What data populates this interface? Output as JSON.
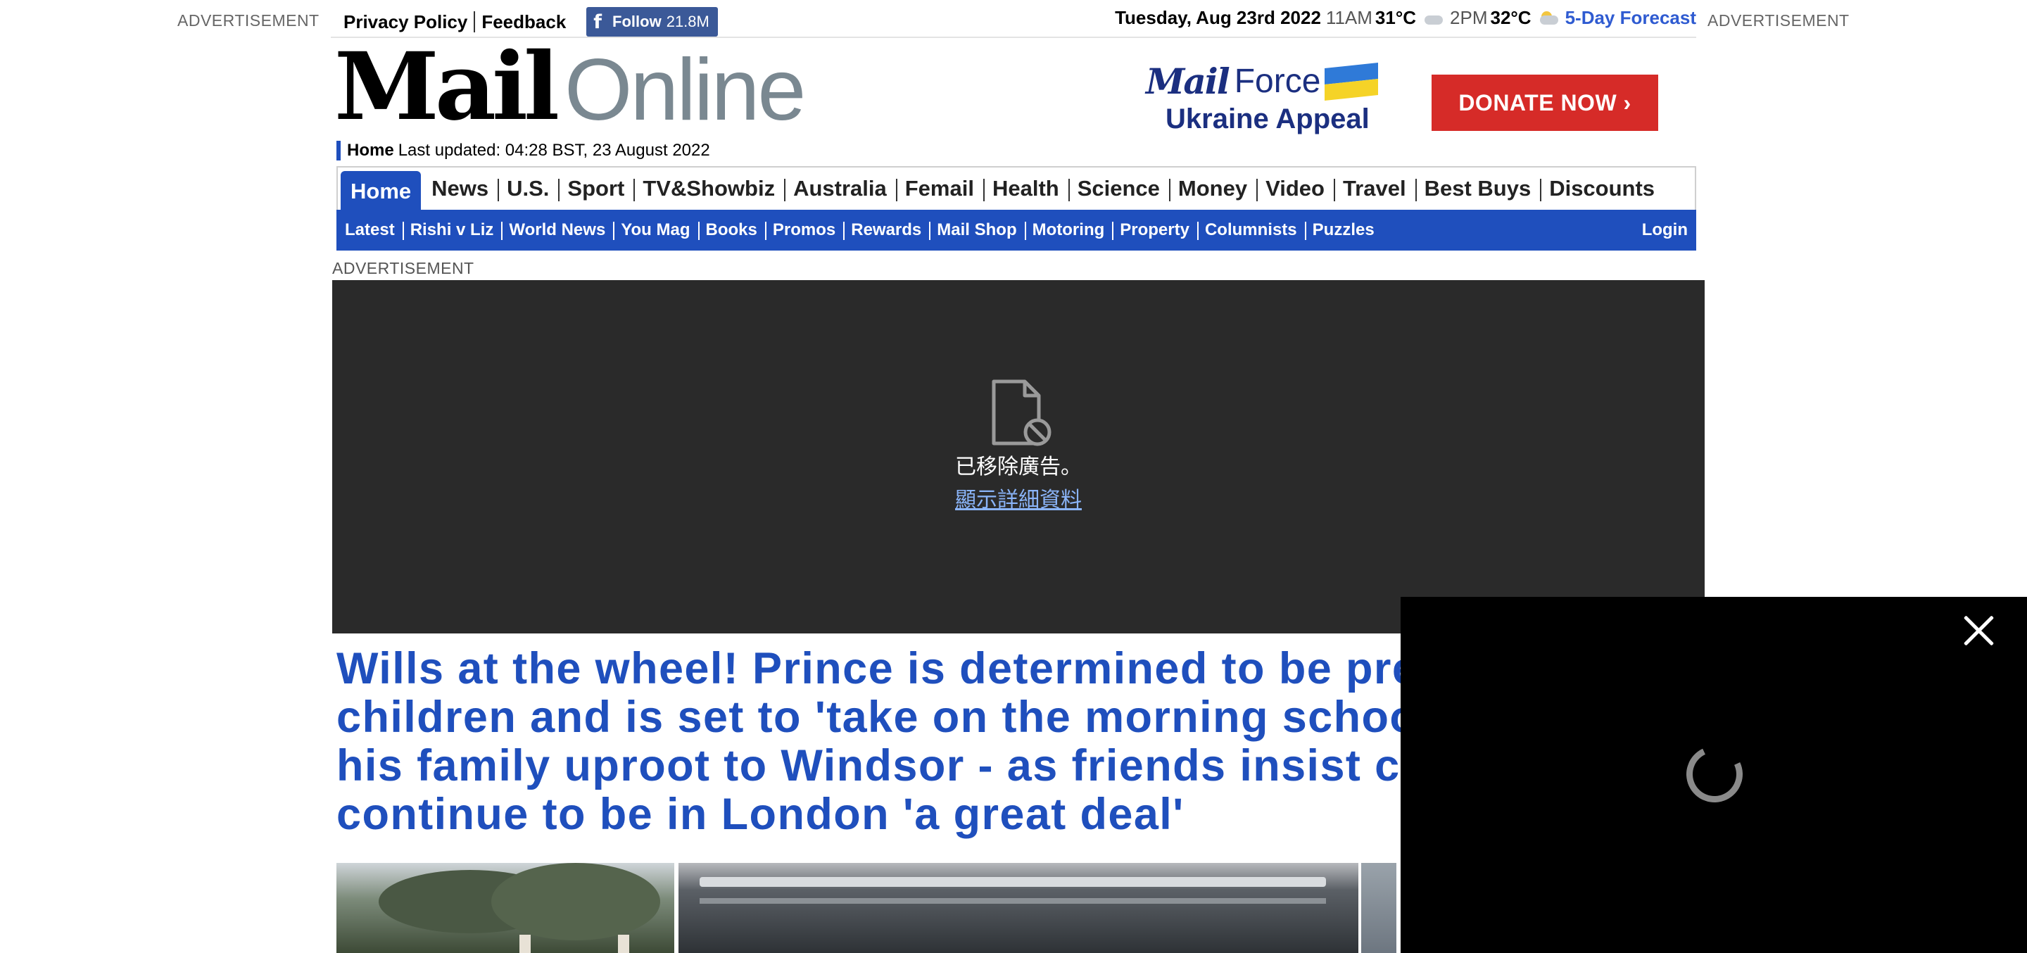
{
  "ads": {
    "left_label": "ADVERTISEMENT",
    "right_label": "ADVERTISEMENT",
    "top_label": "ADVERTISEMENT",
    "removed_text": "已移除廣告。",
    "details_link": "顯示詳細資料"
  },
  "topbar": {
    "privacy": "Privacy Policy",
    "feedback": "Feedback",
    "facebook": {
      "icon": "facebook-icon",
      "label": "Follow",
      "count": "21.8M",
      "color": "#3b5998"
    },
    "date": "Tuesday, Aug 23rd 2022",
    "weather": [
      {
        "time": "11AM",
        "temp": "31°C",
        "icon": "partly-cloudy-icon"
      },
      {
        "time": "2PM",
        "temp": "32°C",
        "icon": "sun-cloud-icon"
      }
    ],
    "forecast_link": "5-Day Forecast"
  },
  "masthead": {
    "logo_mail": "Mail",
    "logo_online": "Online",
    "promo": {
      "line1": "Mail",
      "line1b": "Force",
      "line2": "Ukraine Appeal",
      "button": "DONATE NOW ›",
      "button_color": "#d62b28"
    },
    "home": "Home",
    "last_updated": "Last updated: 04:28 BST, 23 August 2022"
  },
  "nav": {
    "accent": "#1f4fbd",
    "items": [
      "Home",
      "News",
      "U.S.",
      "Sport",
      "TV&Showbiz",
      "Australia",
      "Femail",
      "Health",
      "Science",
      "Money",
      "Video",
      "Travel",
      "Best Buys",
      "Discounts"
    ],
    "sub_items": [
      "Latest",
      "Rishi v Liz",
      "World News",
      "You Mag",
      "Books",
      "Promos",
      "Rewards",
      "Mail Shop",
      "Motoring",
      "Property",
      "Columnists",
      "Puzzles"
    ],
    "login": "Login"
  },
  "article": {
    "headline": "Wills at the wheel! Prince is determined to be present for his children and is set to 'take on the morning school run' after his family uproot to Windsor - as friends insist couple will continue to be in London 'a great deal'"
  }
}
